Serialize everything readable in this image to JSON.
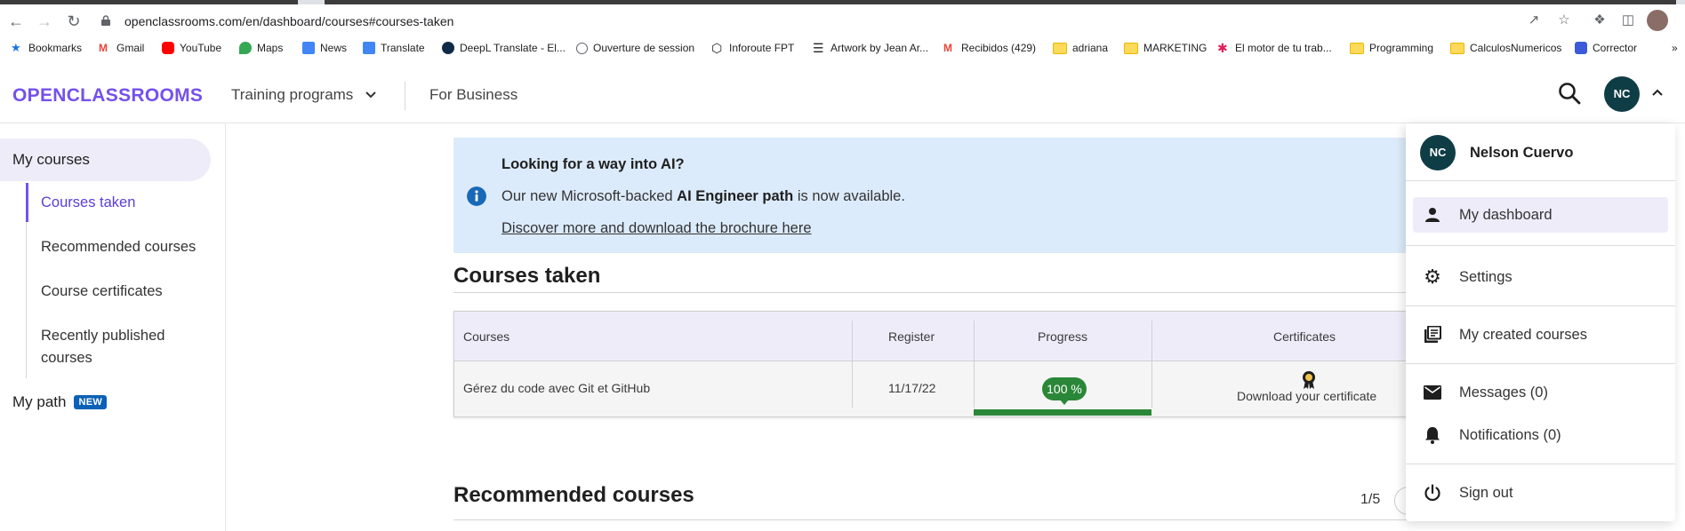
{
  "browser": {
    "url": "openclassrooms.com/en/dashboard/courses#courses-taken",
    "bookmarks": [
      {
        "label": "Bookmarks",
        "icon": "star-icon",
        "color": "#1a73e8"
      },
      {
        "label": "Gmail",
        "icon": "gmail-icon",
        "color": "#ea4335"
      },
      {
        "label": "YouTube",
        "icon": "youtube-icon",
        "color": "#ff0000"
      },
      {
        "label": "Maps",
        "icon": "maps-icon",
        "color": "#34a853"
      },
      {
        "label": "News",
        "icon": "news-icon",
        "color": "#4285f4"
      },
      {
        "label": "Translate",
        "icon": "translate-icon",
        "color": "#4285f4"
      },
      {
        "label": "DeepL Translate - El...",
        "icon": "deepl-icon",
        "color": "#0f2b46"
      },
      {
        "label": "Ouverture de session",
        "icon": "globe-icon",
        "color": "#5f6368"
      },
      {
        "label": "Inforoute FPT",
        "icon": "hexagon-icon",
        "color": "#202124"
      },
      {
        "label": "Artwork by Jean Ar...",
        "icon": "artwork-icon",
        "color": "#202124"
      },
      {
        "label": "Recibidos (429)",
        "icon": "gmail-icon",
        "color": "#ea4335"
      },
      {
        "label": "adriana",
        "icon": "folder-icon",
        "color": "#ffd95a"
      },
      {
        "label": "MARKETING",
        "icon": "folder-icon",
        "color": "#ffd95a"
      },
      {
        "label": "El motor de tu trab...",
        "icon": "slack-icon",
        "color": "#e01e5a"
      },
      {
        "label": "Programming",
        "icon": "folder-icon",
        "color": "#ffd95a"
      },
      {
        "label": "CalculosNumericos",
        "icon": "folder-icon",
        "color": "#ffd95a"
      },
      {
        "label": "Corrector",
        "icon": "corrector-icon",
        "color": "#3b5bdb"
      }
    ],
    "more": "»"
  },
  "header": {
    "logo": "OPENCLASSROOMS",
    "training_programs": "Training programs",
    "for_business": "For Business",
    "avatar_initials": "NC"
  },
  "sidebar": {
    "my_courses": "My courses",
    "items": [
      {
        "label": "Courses taken"
      },
      {
        "label": "Recommended courses"
      },
      {
        "label": "Course certificates"
      },
      {
        "label": "Recently published courses"
      }
    ],
    "my_path": "My path",
    "new_badge": "NEW"
  },
  "banner": {
    "title": "Looking for a way into AI?",
    "text_before": "Our new Microsoft-backed ",
    "text_bold": "AI Engineer path",
    "text_after": " is now available.",
    "link": "Discover more and download the brochure here"
  },
  "courses_taken": {
    "title": "Courses taken",
    "columns": [
      "Courses",
      "Register",
      "Progress",
      "Certificates"
    ],
    "rows": [
      {
        "course": "Gérez du code avec Git et GitHub",
        "register": "11/17/22",
        "progress_label": "100 %",
        "progress": 1.0,
        "certificate": "Download your certificate"
      }
    ]
  },
  "recommended": {
    "title": "Recommended courses",
    "pager": "1/5"
  },
  "user_menu": {
    "initials": "NC",
    "name": "Nelson Cuervo",
    "items": [
      {
        "label": "My dashboard",
        "icon": "person-icon"
      },
      {
        "label": "Settings",
        "icon": "gear-icon"
      },
      {
        "label": "My created courses",
        "icon": "library-icon"
      },
      {
        "label": "Messages (0)",
        "icon": "mail-icon"
      },
      {
        "label": "Notifications (0)",
        "icon": "bell-icon"
      },
      {
        "label": "Sign out",
        "icon": "power-icon"
      }
    ]
  },
  "colors": {
    "brand": "#7451eb",
    "banner_bg": "#dcebfb",
    "progress": "#2b8738",
    "avatar": "#0f3d45"
  }
}
